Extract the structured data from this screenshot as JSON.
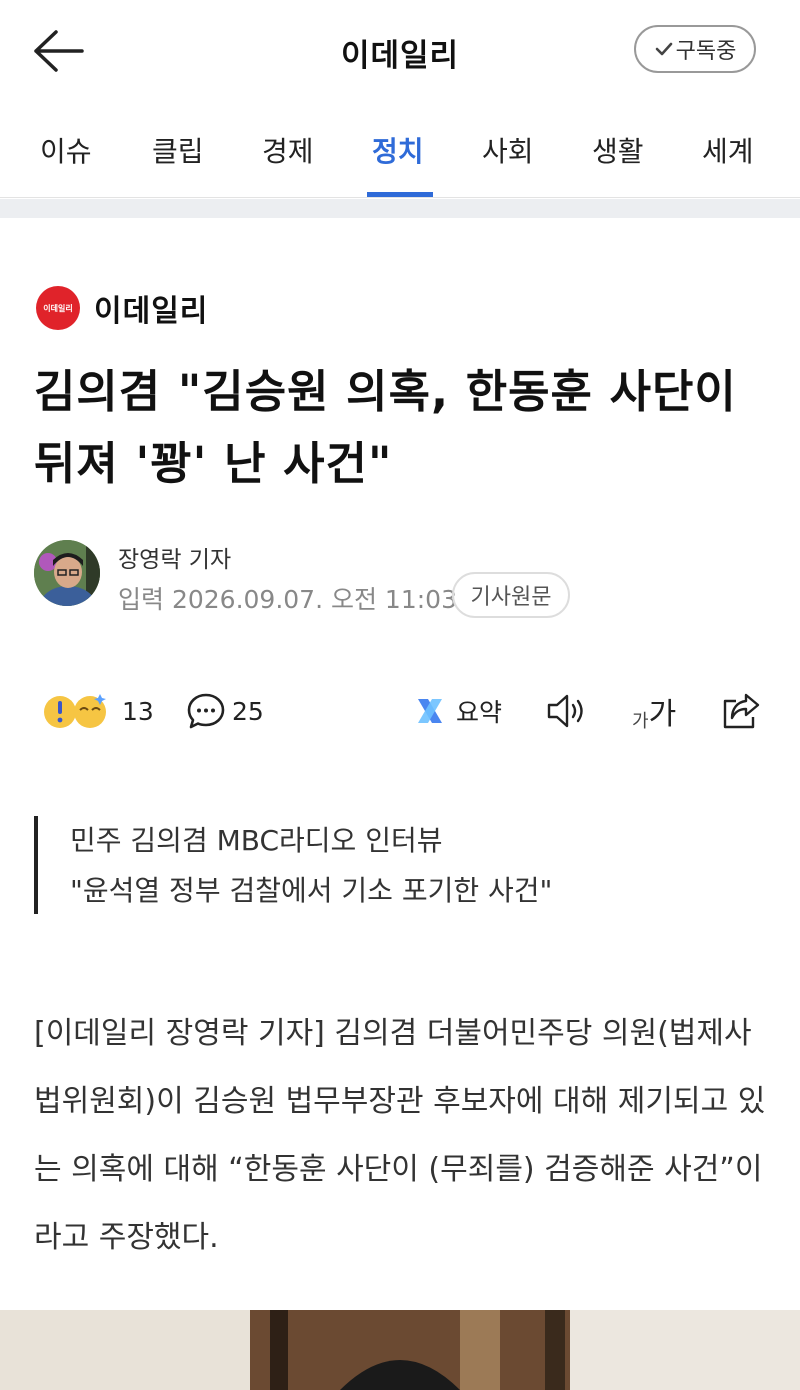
{
  "header": {
    "title": "이데일리",
    "subscribe_label": "구독중"
  },
  "tabs": [
    {
      "label": "이슈"
    },
    {
      "label": "클립"
    },
    {
      "label": "경제"
    },
    {
      "label": "정치"
    },
    {
      "label": "사회"
    },
    {
      "label": "생활"
    },
    {
      "label": "세계"
    }
  ],
  "active_tab": "정치",
  "article": {
    "press_name": "이데일리",
    "press_logo_text": "이데일리",
    "headline": "김의겸 \"김승원 의혹, 한동훈 사단이 뒤져 '꽝' 난 사건\"",
    "reporter": "장영락 기자",
    "published": "입력 2026.09.07. 오전 11:03",
    "original_label": "기사원문",
    "reaction_count": "13",
    "comment_count": "25",
    "summary_label": "요약",
    "font_size_label_small": "가",
    "font_size_label_large": "가",
    "quote_lines": [
      "민주 김의겸 MBC라디오 인터뷰",
      "\"윤석열 정부 검찰에서 기소 포기한 사건\""
    ],
    "body": "[이데일리 장영락 기자] 김의겸 더불어민주당 의원(법제사법위원회)이 김승원 법무부장관 후보자에 대해 제기되고 있는 의혹에 대해 “한동훈 사단이 (무죄를) 검증해준 사건”이라고 주장했다."
  },
  "colors": {
    "accent": "#2f6bd8",
    "press_red": "#e0232a",
    "text": "#111111",
    "muted": "#888888"
  },
  "icons": [
    "back-arrow-icon",
    "check-icon",
    "reaction-icon",
    "comment-icon",
    "summary-icon",
    "speaker-icon",
    "font-size-icon",
    "share-icon"
  ]
}
